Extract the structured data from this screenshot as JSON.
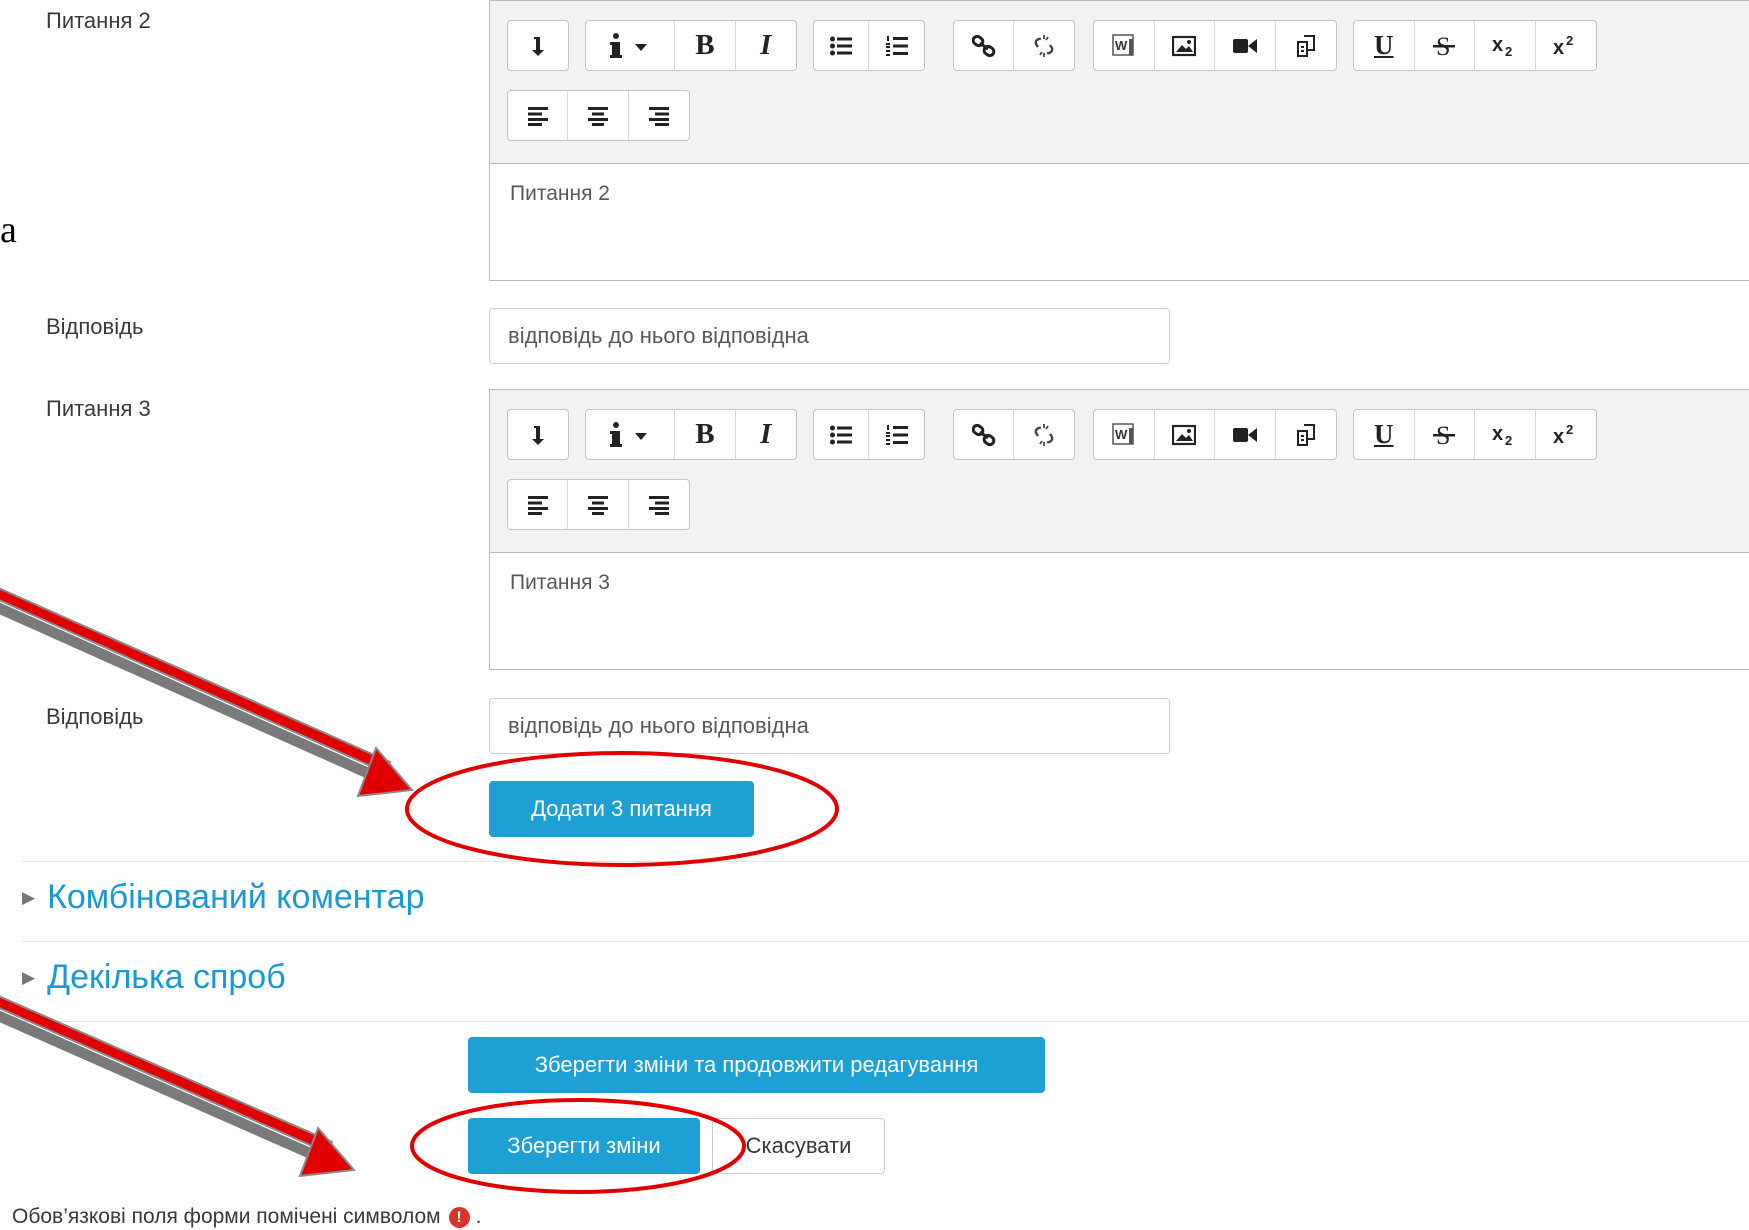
{
  "questions": [
    {
      "label": "Питання 2",
      "text": "Питання 2",
      "answer_label": "Відповідь",
      "answer_value": "відповідь до нього відповідна"
    },
    {
      "label": "Питання 3",
      "text": "Питання 3",
      "answer_label": "Відповідь",
      "answer_value": "відповідь до нього відповідна"
    }
  ],
  "toolbar_icons": [
    "collapse-icon",
    "info-dropdown-icon",
    "bold-icon",
    "italic-icon",
    "unordered-list-icon",
    "ordered-list-icon",
    "link-icon",
    "unlink-icon",
    "word-paste-icon",
    "image-icon",
    "video-icon",
    "manage-files-icon",
    "underline-icon",
    "strikethrough-icon",
    "subscript-icon",
    "superscript-icon",
    "align-left-icon",
    "align-center-icon",
    "align-right-icon"
  ],
  "toolbar_glyphs": {
    "bold": "B",
    "italic": "I",
    "underline": "U"
  },
  "add_questions_button": "Додати 3 питання",
  "sections": [
    {
      "label": "Комбінований коментар"
    },
    {
      "label": "Декілька спроб"
    }
  ],
  "buttons": {
    "save_continue": "Зберегти зміни та продовжити редагування",
    "save": "Зберегти зміни",
    "cancel": "Скасувати"
  },
  "footnote": {
    "text": "Обов’язкові поля форми помічені символом",
    "suffix": "."
  },
  "colors": {
    "primary": "#1ea0d5",
    "link": "#1b9ad2",
    "annotation": "#e00000",
    "required": "#d9342b"
  },
  "annotation_fragment": "a"
}
